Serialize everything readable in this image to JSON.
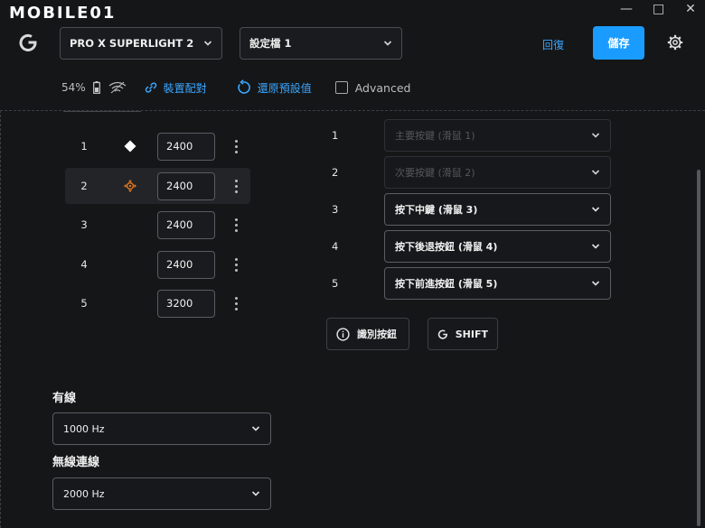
{
  "watermark": "MOBILE01",
  "window_controls": {
    "minimize": "—",
    "maximize": "□",
    "close": "✕"
  },
  "header": {
    "device": "PRO X SUPERLIGHT 2",
    "profile": "設定檔 1",
    "revert_label": "回復",
    "save_label": "儲存"
  },
  "status": {
    "battery": "54%",
    "pair_label": "裝置配對",
    "reset_label": "還原預設值",
    "advanced_label": "Advanced"
  },
  "dpi_levels": [
    {
      "index": "1",
      "value": "2400",
      "icon": "diamond-icon"
    },
    {
      "index": "2",
      "value": "2400",
      "icon": "crosshair-icon"
    },
    {
      "index": "3",
      "value": "2400",
      "icon": ""
    },
    {
      "index": "4",
      "value": "2400",
      "icon": ""
    },
    {
      "index": "5",
      "value": "3200",
      "icon": ""
    }
  ],
  "buttons": [
    {
      "index": "1",
      "label": "主要按鍵 (滑鼠 1)",
      "enabled": false
    },
    {
      "index": "2",
      "label": "次要按鍵 (滑鼠 2)",
      "enabled": false
    },
    {
      "index": "3",
      "label": "按下中鍵 (滑鼠 3)",
      "enabled": true
    },
    {
      "index": "4",
      "label": "按下後退按鈕 (滑鼠 4)",
      "enabled": true
    },
    {
      "index": "5",
      "label": "按下前進按鈕 (滑鼠 5)",
      "enabled": true
    }
  ],
  "actions": {
    "identify_label": "識別按鈕",
    "shift_label": "SHIFT"
  },
  "wired": {
    "label": "有線",
    "rate": "1000 Hz"
  },
  "wireless": {
    "label": "無線連線",
    "rate": "2000 Hz"
  },
  "colors": {
    "accent": "#1a9cff",
    "link": "#3aa7ff",
    "active_icon": "#f07c1e",
    "background": "#151618"
  }
}
